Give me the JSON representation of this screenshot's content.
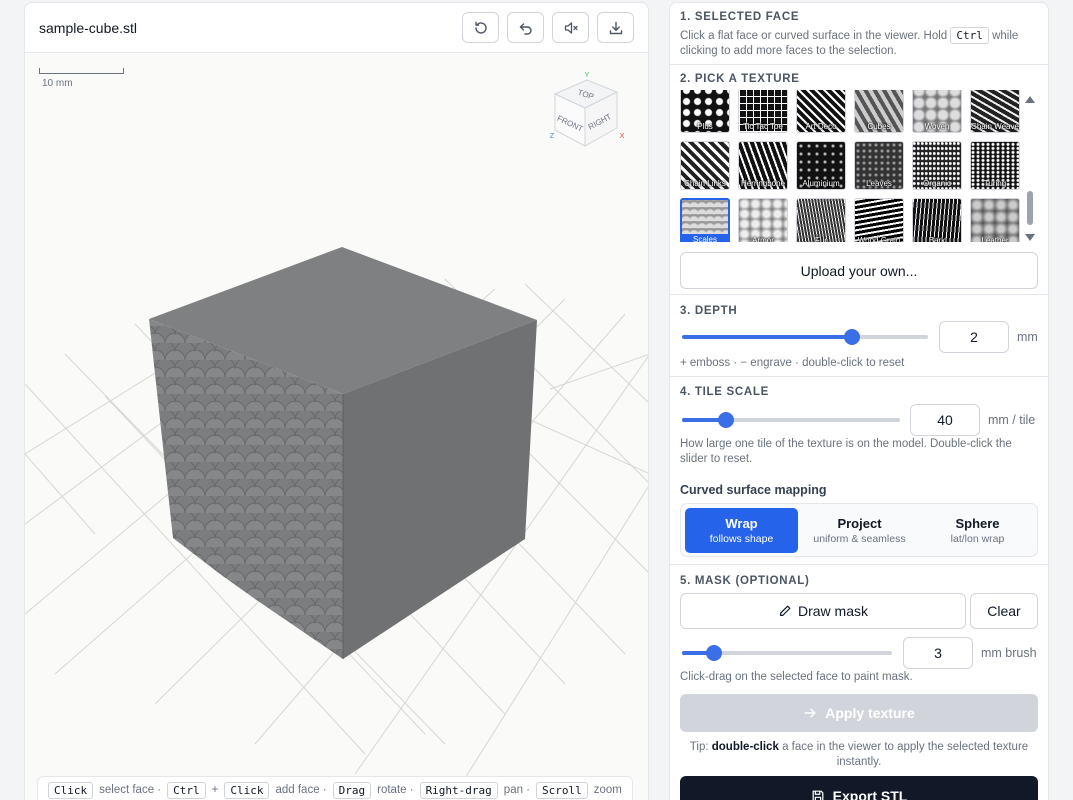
{
  "viewer": {
    "file_name": "sample-cube.stl",
    "toolbar": [
      {
        "name": "reset-view-button",
        "icon": "rotate-ccw-icon"
      },
      {
        "name": "undo-button",
        "icon": "undo-icon"
      },
      {
        "name": "mute-button",
        "icon": "volume-mute-icon"
      },
      {
        "name": "download-button",
        "icon": "download-icon"
      }
    ],
    "scale_label": "10 mm",
    "view_cube": {
      "top": "TOP",
      "front": "FRONT",
      "right": "RIGHT",
      "axis_x": "X",
      "axis_y": "Y",
      "axis_z": "Z"
    },
    "hints": [
      {
        "key": "Click",
        "text": "select face ·"
      },
      {
        "key": "Ctrl",
        "text": "+"
      },
      {
        "key": "Click",
        "text": "add face ·"
      },
      {
        "key": "Drag",
        "text": "rotate ·"
      },
      {
        "key": "Right-drag",
        "text": "pan ·"
      },
      {
        "key": "Scroll",
        "text": "zoom"
      }
    ]
  },
  "panel": {
    "selected_face": {
      "title": "1. SELECTED FACE",
      "text_before": "Click a flat face or curved surface in the viewer. Hold",
      "key": "Ctrl",
      "text_mid": "while",
      "text_after": "clicking to add more faces to the selection."
    },
    "texture": {
      "title": "2. PICK A TEXTURE",
      "items": [
        {
          "label": "Plus",
          "pattern": "plus"
        },
        {
          "label": "Tic Tac Toe",
          "pattern": "grid"
        },
        {
          "label": "Art Deco",
          "pattern": "deco"
        },
        {
          "label": "Cubes",
          "pattern": "cubes"
        },
        {
          "label": "Woven",
          "pattern": "woven"
        },
        {
          "label": "Chain Weave",
          "pattern": "chainweave"
        },
        {
          "label": "Chain Links",
          "pattern": "links"
        },
        {
          "label": "Herringbone",
          "pattern": "herring"
        },
        {
          "label": "Aluminium",
          "pattern": "alu"
        },
        {
          "label": "Leaves",
          "pattern": "leaves"
        },
        {
          "label": "Organic",
          "pattern": "organic"
        },
        {
          "label": "Turing",
          "pattern": "turing"
        },
        {
          "label": "Scales",
          "pattern": "scales",
          "selected": true
        },
        {
          "label": "Armor",
          "pattern": "armor"
        },
        {
          "label": "Fur",
          "pattern": "fur"
        },
        {
          "label": "Wood Grain",
          "pattern": "wood"
        },
        {
          "label": "Bark",
          "pattern": "bark"
        },
        {
          "label": "Leather",
          "pattern": "leather"
        }
      ],
      "upload_label": "Upload your own..."
    },
    "depth": {
      "title": "3. DEPTH",
      "value": "2",
      "unit": "mm",
      "slider_fraction": 0.69,
      "hint": "+ emboss · − engrave · double-click to reset"
    },
    "tile_scale": {
      "title": "4. TILE SCALE",
      "value": "40",
      "unit": "mm / tile",
      "slider_fraction": 0.2,
      "hint": "How large one tile of the texture is on the model. Double-click the slider to reset.",
      "mapping_title": "Curved surface mapping",
      "mapping_options": [
        {
          "title": "Wrap",
          "sub": "follows shape",
          "active": true
        },
        {
          "title": "Project",
          "sub": "uniform & seamless",
          "active": false
        },
        {
          "title": "Sphere",
          "sub": "lat/lon wrap",
          "active": false
        }
      ]
    },
    "mask": {
      "title": "5. MASK (OPTIONAL)",
      "draw_label": "Draw mask",
      "clear_label": "Clear",
      "brush_value": "3",
      "brush_unit": "mm brush",
      "slider_fraction": 0.15,
      "hint": "Click-drag on the selected face to paint mask."
    },
    "apply_label": "Apply texture",
    "tip_prefix": "Tip:",
    "tip_bold": "double-click",
    "tip_rest": "a face in the viewer to apply the selected texture instantly.",
    "export_label": "Export STL"
  }
}
